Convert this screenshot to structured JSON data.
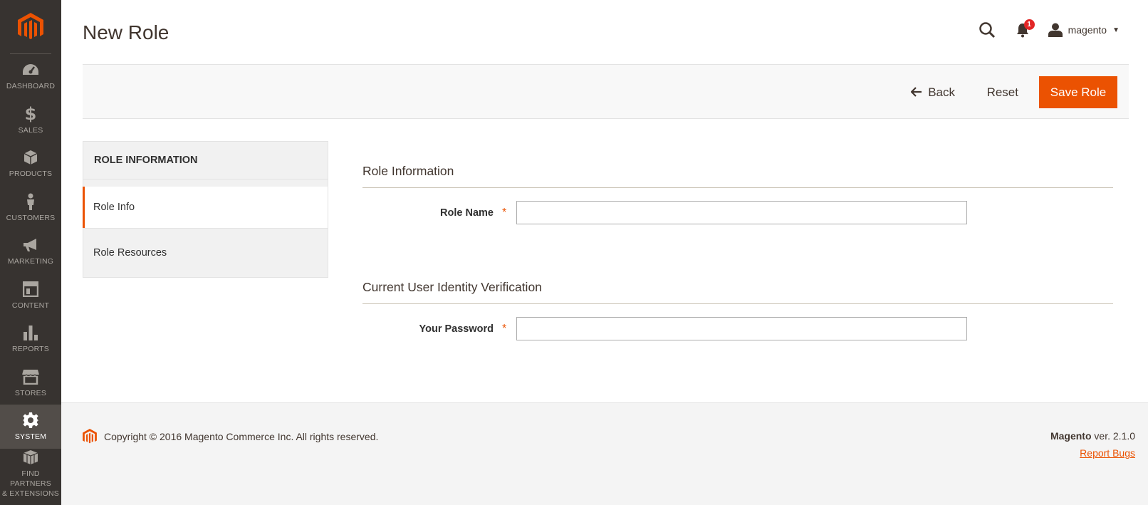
{
  "sidebar": {
    "logo_icon": "magento-logo-icon",
    "items": [
      {
        "label": "DASHBOARD",
        "icon": "dashboard-icon"
      },
      {
        "label": "SALES",
        "icon": "dollar-icon"
      },
      {
        "label": "PRODUCTS",
        "icon": "cube-icon"
      },
      {
        "label": "CUSTOMERS",
        "icon": "person-icon"
      },
      {
        "label": "MARKETING",
        "icon": "megaphone-icon"
      },
      {
        "label": "CONTENT",
        "icon": "layout-icon"
      },
      {
        "label": "REPORTS",
        "icon": "bar-chart-icon"
      },
      {
        "label": "STORES",
        "icon": "store-icon"
      },
      {
        "label": "SYSTEM",
        "icon": "gear-icon"
      },
      {
        "label_line1": "FIND PARTNERS",
        "label_line2": "& EXTENSIONS",
        "icon": "blocks-icon"
      }
    ]
  },
  "header": {
    "title": "New Role",
    "notifications_count": "1",
    "username": "magento"
  },
  "actions": {
    "back_label": "Back",
    "reset_label": "Reset",
    "save_label": "Save Role"
  },
  "tabs": {
    "title": "ROLE INFORMATION",
    "items": [
      {
        "label": "Role Info"
      },
      {
        "label": "Role Resources"
      }
    ]
  },
  "form": {
    "role_section_title": "Role Information",
    "role_name_label": "Role Name",
    "role_name_value": "",
    "verify_section_title": "Current User Identity Verification",
    "password_label": "Your Password",
    "password_value": "",
    "required_mark": "*"
  },
  "footer": {
    "copyright": "Copyright © 2016 Magento Commerce Inc. All rights reserved.",
    "brand": "Magento",
    "version": " ver. 2.1.0",
    "report_bugs": "Report Bugs"
  },
  "colors": {
    "accent": "#eb5202",
    "sidebar_bg": "#373330",
    "sidebar_active": "#524d49"
  }
}
